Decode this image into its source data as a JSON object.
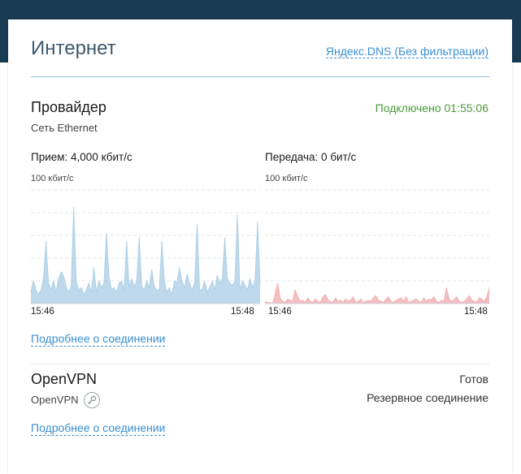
{
  "header": {
    "title": "Интернет",
    "dns_link": "Яндекс.DNS (Без фильтрации)"
  },
  "provider": {
    "title": "Провайдер",
    "subtitle": "Сеть Ethernet",
    "status": "Подключено 01:55:06",
    "receive": {
      "label": "Прием: 4,000 кбит/с",
      "scale": "100 кбит/с",
      "time_start": "15:46",
      "time_end": "15:48",
      "color": "#a8cce4",
      "values": [
        10,
        20,
        12,
        8,
        12,
        22,
        55,
        18,
        12,
        20,
        10,
        22,
        28,
        24,
        15,
        10,
        16,
        85,
        20,
        12,
        14,
        8,
        12,
        18,
        10,
        32,
        10,
        20,
        14,
        18,
        62,
        24,
        12,
        14,
        10,
        18,
        20,
        12,
        55,
        14,
        22,
        15,
        20,
        58,
        15,
        12,
        20,
        14,
        30,
        15,
        12,
        12,
        55,
        20,
        10,
        14,
        8,
        20,
        18,
        32,
        20,
        14,
        26,
        18,
        12,
        18,
        70,
        12,
        12,
        20,
        10,
        14,
        20,
        12,
        25,
        18,
        22,
        58,
        22,
        18,
        16,
        20,
        78,
        12,
        20,
        16,
        12,
        22,
        14,
        20,
        72,
        18
      ]
    },
    "send": {
      "label": "Передача: 0 бит/с",
      "scale": "100 кбит/с",
      "time_start": "15:46",
      "time_end": "15:48",
      "color": "#f2a8ac",
      "values": [
        2,
        1,
        1,
        0,
        8,
        18,
        5,
        2,
        1,
        4,
        3,
        2,
        12,
        6,
        2,
        3,
        1,
        5,
        2,
        1,
        4,
        2,
        1,
        6,
        8,
        3,
        2,
        1,
        5,
        2,
        3,
        1,
        4,
        2,
        3,
        6,
        1,
        2,
        4,
        1,
        2,
        3,
        2,
        5,
        7,
        3,
        2,
        1,
        4,
        6,
        2,
        1,
        3,
        4,
        5,
        2,
        6,
        1,
        2,
        3,
        4,
        2,
        1,
        5,
        2,
        4,
        3,
        6,
        2,
        1,
        3,
        2,
        14,
        4,
        2,
        3,
        6,
        2,
        1,
        2,
        4,
        7,
        3,
        2,
        1,
        5,
        4,
        2,
        6,
        14
      ]
    },
    "more_link": "Подробнее о соединении"
  },
  "openvpn": {
    "title": "OpenVPN",
    "subtitle": "OpenVPN",
    "status": "Готов",
    "status2": "Резервное соединение",
    "more_link": "Подробнее о соединении"
  }
}
